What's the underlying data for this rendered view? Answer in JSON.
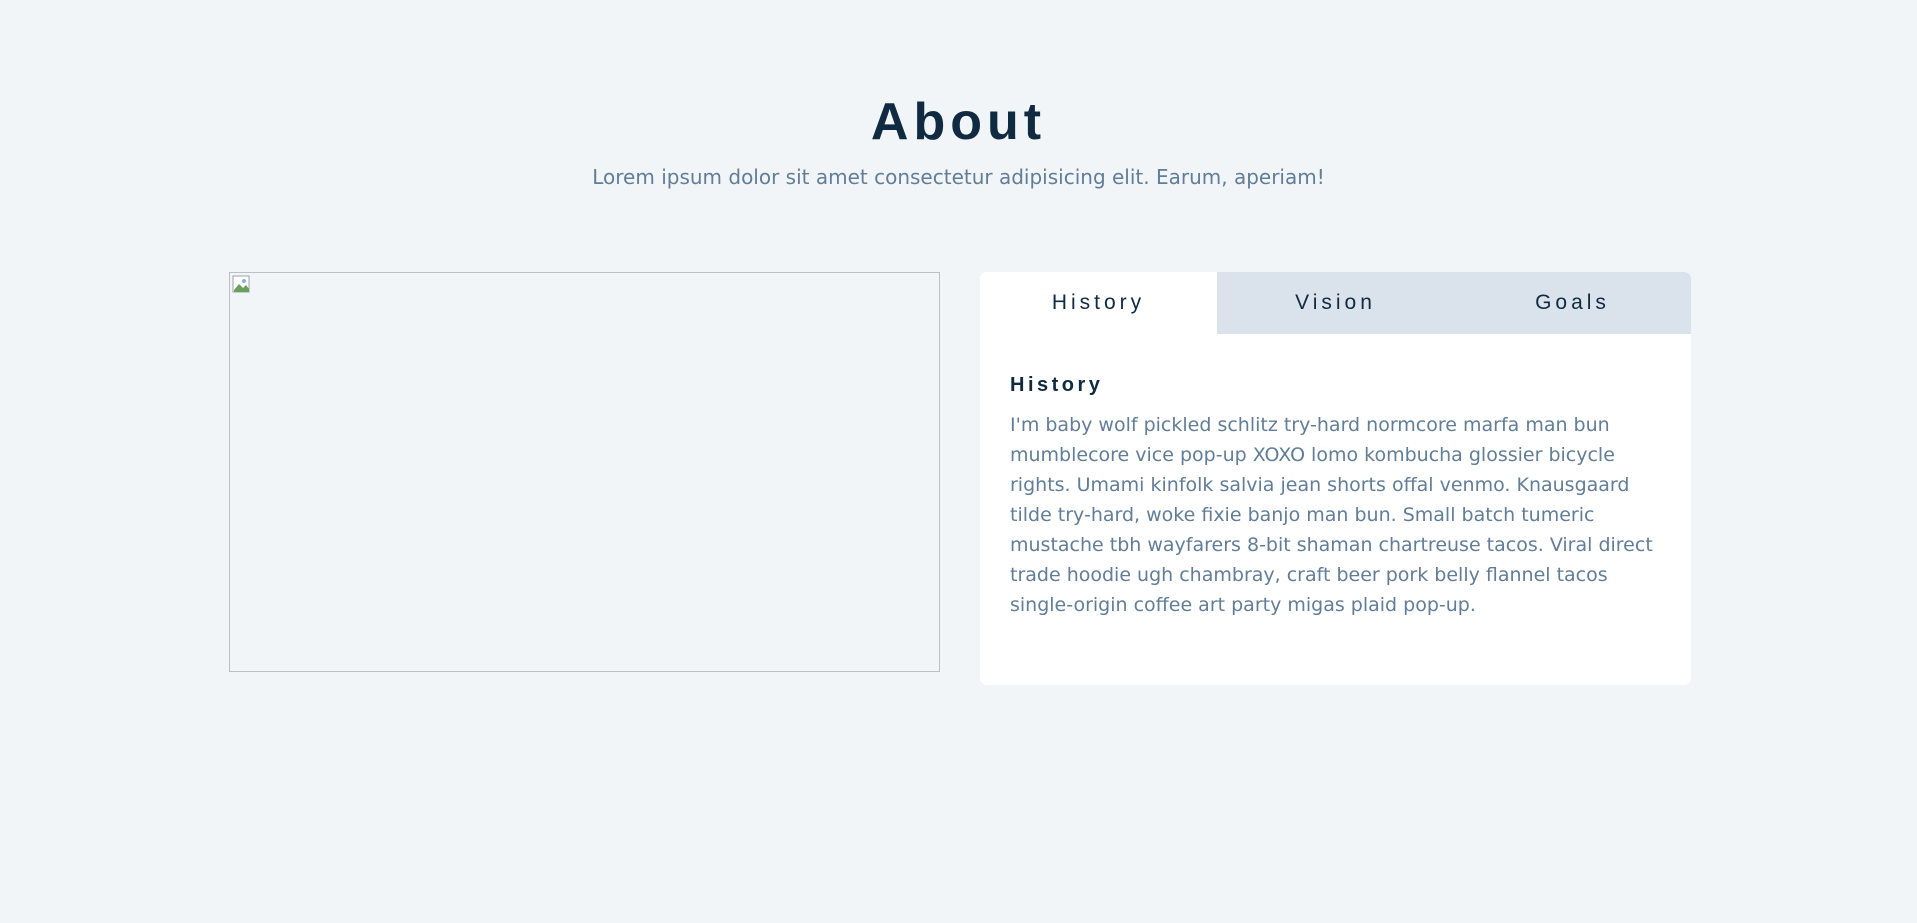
{
  "header": {
    "title": "About",
    "subtitle": "Lorem ipsum dolor sit amet consectetur adipisicing elit. Earum, aperiam!"
  },
  "image": {
    "icon": "broken-image-icon"
  },
  "tabs": [
    {
      "label": "History",
      "active": true
    },
    {
      "label": "Vision",
      "active": false
    },
    {
      "label": "Goals",
      "active": false
    }
  ],
  "content": {
    "title": "History",
    "text": "I'm baby wolf pickled schlitz try-hard normcore marfa man bun mumblecore vice pop-up XOXO lomo kombucha glossier bicycle rights. Umami kinfolk salvia jean shorts offal venmo. Knausgaard tilde try-hard, woke fixie banjo man bun. Small batch tumeric mustache tbh wayfarers 8-bit shaman chartreuse tacos. Viral direct trade hoodie ugh chambray, craft beer pork belly flannel tacos single-origin coffee art party migas plaid pop-up."
  },
  "colors": {
    "background": "#f1f5f8",
    "heading": "#102a42",
    "body_text": "#617d98",
    "tab_inactive": "#dae2ec",
    "card": "#ffffff"
  }
}
